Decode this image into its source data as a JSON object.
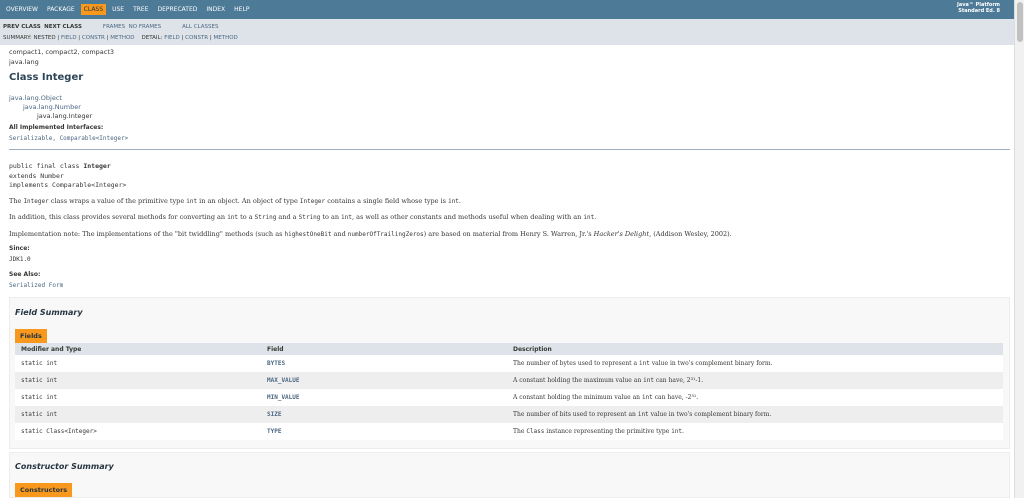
{
  "topnav": {
    "items": [
      "Overview",
      "Package",
      "Class",
      "Use",
      "Tree",
      "Deprecated",
      "Index",
      "Help"
    ],
    "active_index": 2,
    "platform_line1": "Java™ Platform",
    "platform_line2": "Standard Ed. 8"
  },
  "subnav": {
    "prev_class": "PREV CLASS",
    "next_class": "NEXT CLASS",
    "frames": "FRAMES",
    "no_frames": "NO FRAMES",
    "all_classes": "ALL CLASSES",
    "summary_label": "SUMMARY:",
    "summary_items": [
      "NESTED",
      "FIELD",
      "CONSTR",
      "METHOD"
    ],
    "detail_label": "DETAIL:",
    "detail_items": [
      "FIELD",
      "CONSTR",
      "METHOD"
    ]
  },
  "header": {
    "profiles": "compact1, compact2, compact3",
    "package": "java.lang",
    "title": "Class Integer"
  },
  "inheritance": [
    "java.lang.Object",
    "java.lang.Number",
    "java.lang.Integer"
  ],
  "implemented": {
    "label": "All Implemented Interfaces:",
    "value": "Serializable, Comparable<Integer>"
  },
  "declaration": {
    "line1_prefix": "public final class ",
    "line1_name": "Integer",
    "line2": "extends Number",
    "line3": "implements Comparable<Integer>"
  },
  "description": {
    "p1": [
      "The ",
      "Integer",
      " class wraps a value of the primitive type ",
      "int",
      " in an object. An object of type ",
      "Integer",
      " contains a single field whose type is ",
      "int",
      "."
    ],
    "p2": [
      "In addition, this class provides several methods for converting an ",
      "int",
      " to a ",
      "String",
      " and a ",
      "String",
      " to an ",
      "int",
      ", as well as other constants and methods useful when dealing with an ",
      "int",
      "."
    ],
    "p3": [
      "Implementation note: The implementations of the \"bit twiddling\" methods (such as ",
      "highestOneBit",
      " and ",
      "numberOfTrailingZeros",
      ") are based on material from Henry S. Warren, Jr.'s ",
      "Hacker's Delight",
      ", (Addison Wesley, 2002)."
    ]
  },
  "since": {
    "label": "Since:",
    "value": "JDK1.0"
  },
  "see_also": {
    "label": "See Also:",
    "value": "Serialized Form"
  },
  "field_summary": {
    "title": "Field Summary",
    "tab": "Fields",
    "headers": [
      "Modifier and Type",
      "Field",
      "Description"
    ],
    "rows": [
      {
        "modifier": "static int",
        "field": "BYTES",
        "desc": [
          "The number of bytes used to represent a ",
          "int",
          " value in two's complement binary form."
        ]
      },
      {
        "modifier": "static int",
        "field": "MAX_VALUE",
        "desc": [
          "A constant holding the maximum value an ",
          "int",
          " can have, 2³¹-1."
        ]
      },
      {
        "modifier": "static int",
        "field": "MIN_VALUE",
        "desc": [
          "A constant holding the minimum value an ",
          "int",
          " can have, -2³¹."
        ]
      },
      {
        "modifier": "static int",
        "field": "SIZE",
        "desc": [
          "The number of bits used to represent an ",
          "int",
          " value in two's complement binary form."
        ]
      },
      {
        "modifier": "static Class<Integer>",
        "field": "TYPE",
        "desc": [
          "The ",
          "Class",
          " instance representing the primitive type ",
          "int",
          "."
        ]
      }
    ]
  },
  "constructor_summary": {
    "title": "Constructor Summary",
    "tab": "Constructors"
  }
}
